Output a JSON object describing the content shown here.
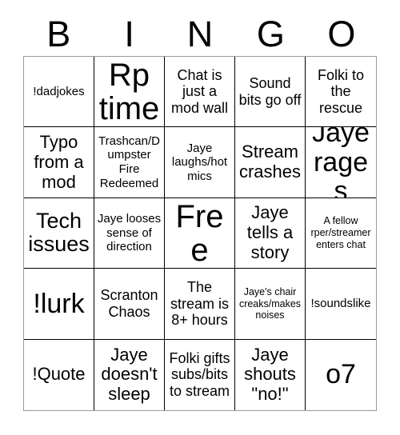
{
  "card": {
    "type": "bingo-card",
    "columns": 5,
    "rows": 5,
    "background_color": "#ffffff",
    "text_color": "#000000",
    "border_color": "#000000",
    "outer_border_color": "#9a9a9a"
  },
  "header": {
    "letters": [
      "B",
      "I",
      "N",
      "G",
      "O"
    ]
  },
  "cells": [
    {
      "text": "!dadjokes",
      "size": "sm",
      "free": false
    },
    {
      "text": "Rp time",
      "size": "huge",
      "free": false
    },
    {
      "text": "Chat is just a mod wall",
      "size": "md",
      "free": false
    },
    {
      "text": "Sound bits go off",
      "size": "md",
      "free": false
    },
    {
      "text": "Folki to the rescue",
      "size": "md",
      "free": false
    },
    {
      "text": "Typo from a mod",
      "size": "lg",
      "free": false
    },
    {
      "text": "Trashcan/Dumpster Fire Redeemed",
      "size": "sm",
      "free": false
    },
    {
      "text": "Jaye laughs/hot mics",
      "size": "sm",
      "free": false
    },
    {
      "text": "Stream crashes",
      "size": "lg",
      "free": false
    },
    {
      "text": "Jaye rages",
      "size": "xxl",
      "free": false
    },
    {
      "text": "Tech issues",
      "size": "xl",
      "free": false
    },
    {
      "text": "Jaye looses sense of direction",
      "size": "sm",
      "free": false
    },
    {
      "text": "Free",
      "size": "huge",
      "free": true
    },
    {
      "text": "Jaye tells a story",
      "size": "lg",
      "free": false
    },
    {
      "text": "A fellow rper/streamer enters chat",
      "size": "xs",
      "free": false
    },
    {
      "text": "!lurk",
      "size": "xxl",
      "free": false
    },
    {
      "text": "Scranton Chaos",
      "size": "md",
      "free": false
    },
    {
      "text": "The stream is 8+ hours",
      "size": "md",
      "free": false
    },
    {
      "text": "Jaye's chair creaks/makes noises",
      "size": "xs",
      "free": false
    },
    {
      "text": "!soundslike",
      "size": "sm",
      "free": false
    },
    {
      "text": "!Quote",
      "size": "lg",
      "free": false
    },
    {
      "text": "Jaye doesn't sleep",
      "size": "lg",
      "free": false
    },
    {
      "text": "Folki gifts subs/bits to stream",
      "size": "md",
      "free": false
    },
    {
      "text": "Jaye shouts \"no!\"",
      "size": "lg",
      "free": false
    },
    {
      "text": "o7",
      "size": "xxl",
      "free": false
    }
  ]
}
